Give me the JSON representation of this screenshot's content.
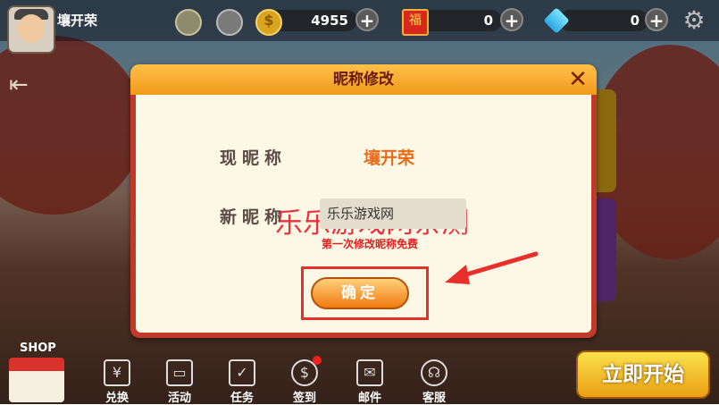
{
  "player": {
    "name": "壤开荣"
  },
  "currencies": {
    "gold": "4955",
    "redpacket": "0",
    "diamond": "0"
  },
  "dialog": {
    "title": "昵称修改",
    "current_label": "现昵称",
    "current_value": "壤开荣",
    "watermark": "乐乐游戏网亲测",
    "new_label": "新昵称",
    "new_value": "乐乐游戏网",
    "free_note": "第一次修改昵称免费",
    "confirm_label": "确定"
  },
  "bottom_nav": [
    {
      "label": "兑换"
    },
    {
      "label": "活动"
    },
    {
      "label": "任务"
    },
    {
      "label": "签到"
    },
    {
      "label": "邮件"
    },
    {
      "label": "客服"
    }
  ],
  "shop_label": "SHOP",
  "start_label": "立即开始",
  "colors": {
    "dialog_border": "#c0392b",
    "header": "#f19a1b",
    "highlight": "#e8302a",
    "watermark": "#e8333f"
  }
}
